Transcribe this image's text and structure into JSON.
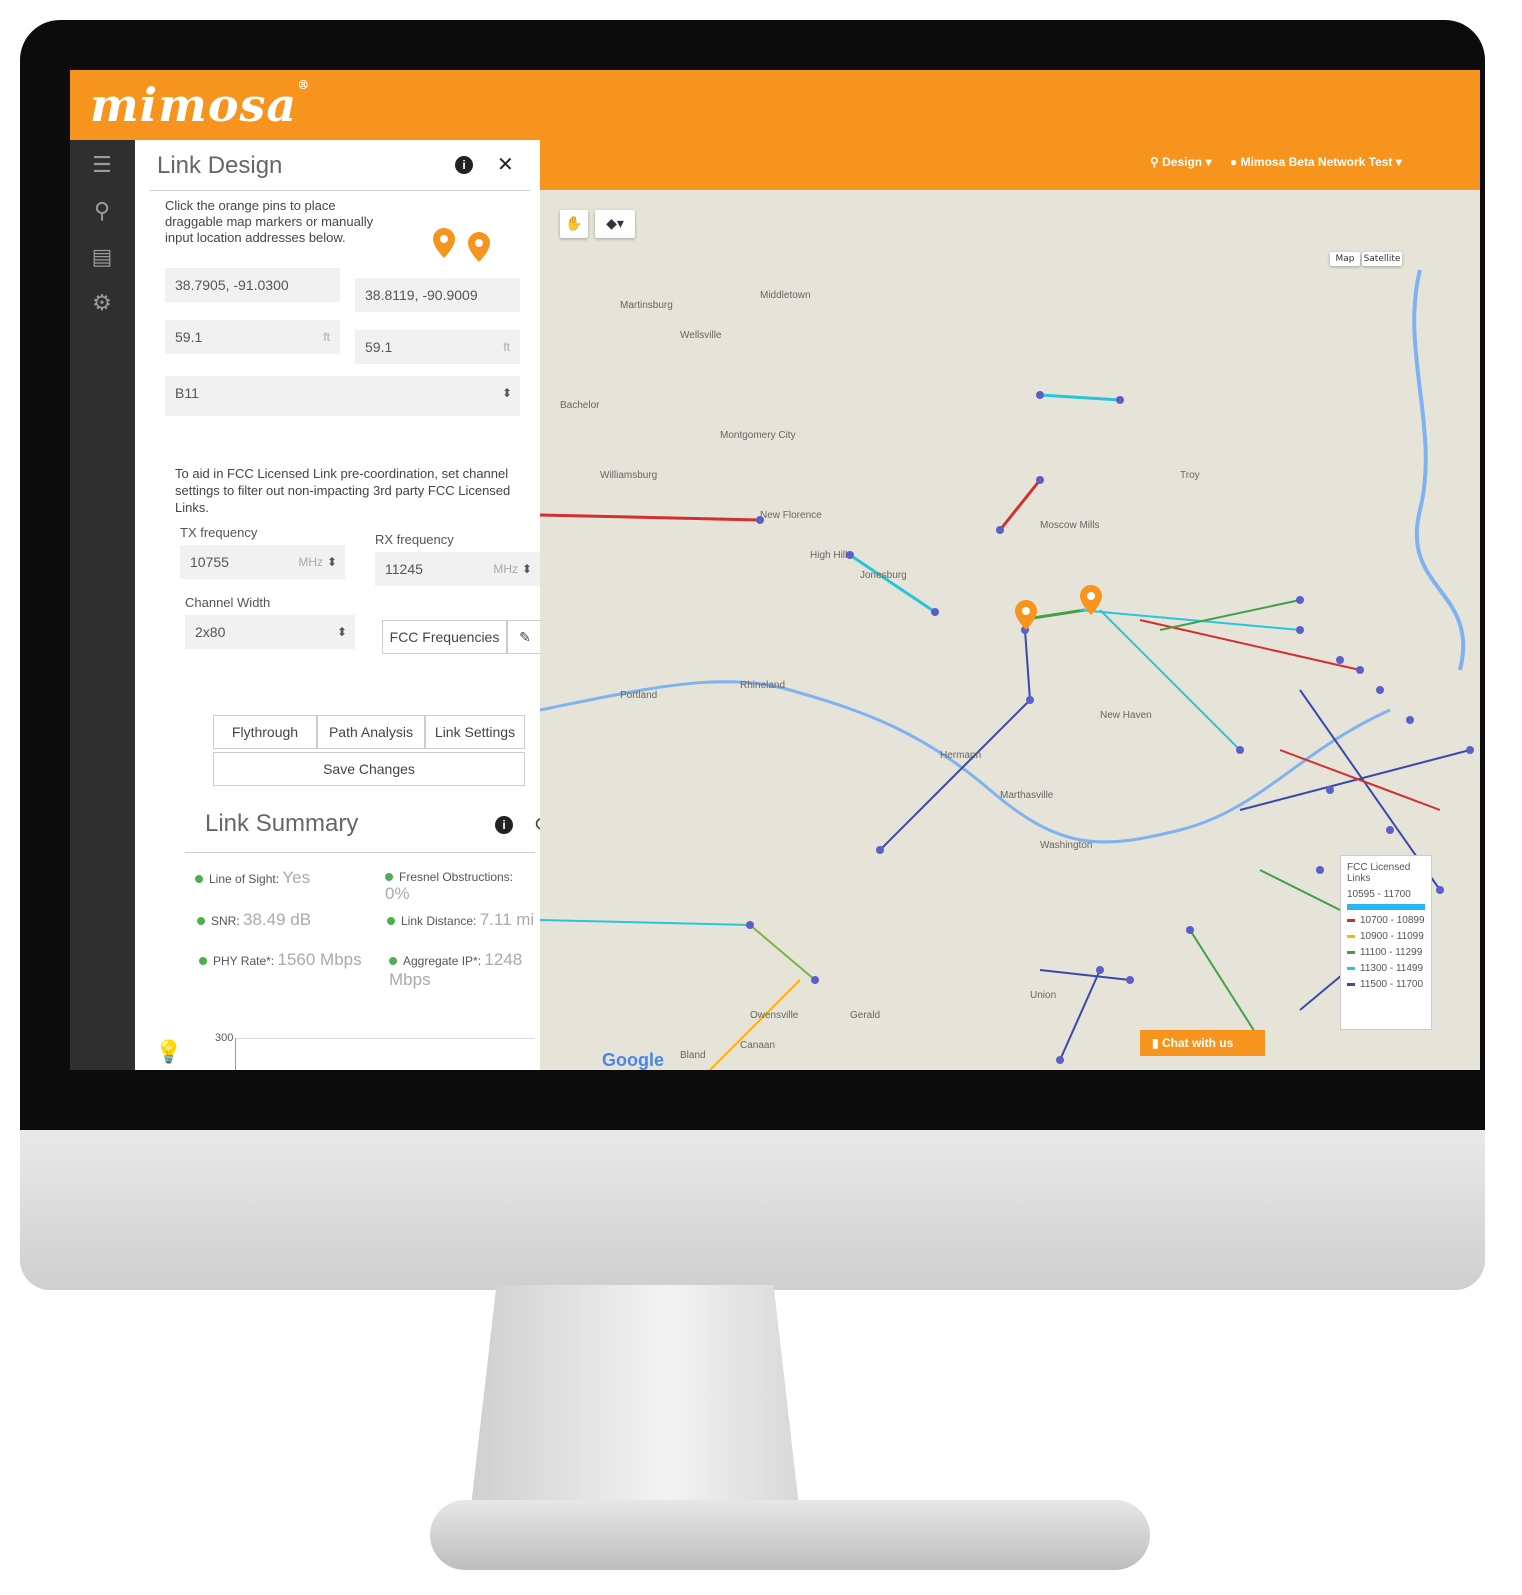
{
  "brand": {
    "logo_text": "mimosa",
    "accent": "#f7941d"
  },
  "sidebar": {
    "icons": [
      "list-icon",
      "location-pins-icon",
      "layers-icon",
      "gear-icon",
      "lightbulb-icon"
    ]
  },
  "link_design": {
    "title": "Link Design",
    "description": "Click the orange pins to place draggable map markers or manually input location addresses below.",
    "location_a": "38.7905, -91.0300",
    "location_b": "38.8119, -90.9009",
    "height_a": "59.1",
    "height_b": "59.1",
    "height_unit": "ft",
    "radio_model": "B11",
    "fcc_note": "To aid in FCC Licensed Link pre-coordination, set channel settings to filter out non-impacting 3rd party FCC Licensed Links.",
    "tx_label": "TX frequency",
    "tx_value": "10755",
    "rx_label": "RX frequency",
    "rx_value": "11245",
    "freq_unit": "MHz",
    "channel_width_label": "Channel Width",
    "channel_width_value": "2x80",
    "fcc_button": "FCC Frequencies",
    "tabs": [
      "Flythrough",
      "Path Analysis",
      "Link Settings"
    ],
    "save_button": "Save Changes"
  },
  "link_summary": {
    "title": "Link Summary",
    "line_of_sight_label": "Line of Sight:",
    "line_of_sight_value": "Yes",
    "fresnel_label": "Fresnel Obstructions:",
    "fresnel_value": "0%",
    "snr_label": "SNR:",
    "snr_value": "38.49 dB",
    "distance_label": "Link Distance:",
    "distance_value": "7.11 mi",
    "phy_label": "PHY Rate*:",
    "phy_value": "1560 Mbps",
    "agg_label": "Aggregate IP*:",
    "agg_value": "1248 Mbps",
    "chart_axis_top": "300"
  },
  "map": {
    "nav_design": "Design",
    "nav_network": "Mimosa Beta Network Test",
    "map_types": [
      "Map",
      "Satellite"
    ],
    "legend_title": "FCC Licensed Links",
    "legend_range": "10595 - 11700",
    "legend_rows": [
      {
        "label": "10700 - 10899",
        "color": "#d32f2f"
      },
      {
        "label": "10900 - 11099",
        "color": "#ffb300"
      },
      {
        "label": "11100 - 11299",
        "color": "#43a047"
      },
      {
        "label": "11300 - 11499",
        "color": "#26c6da"
      },
      {
        "label": "11500 - 11700",
        "color": "#3949ab"
      }
    ],
    "chat": "Chat with us",
    "google": "Google",
    "place_labels": [
      "Martinsburg",
      "Wellsville",
      "Middletown",
      "Bachelor",
      "Montgomery City",
      "Williamsburg",
      "New Florence",
      "High Hill",
      "Jonesburg",
      "Portland",
      "Rhineland",
      "Hermann",
      "Marthasville",
      "Washington",
      "New Haven",
      "Moscow Mills",
      "Troy",
      "Union",
      "Bland",
      "Canaan",
      "Owensville",
      "Gerald"
    ]
  }
}
